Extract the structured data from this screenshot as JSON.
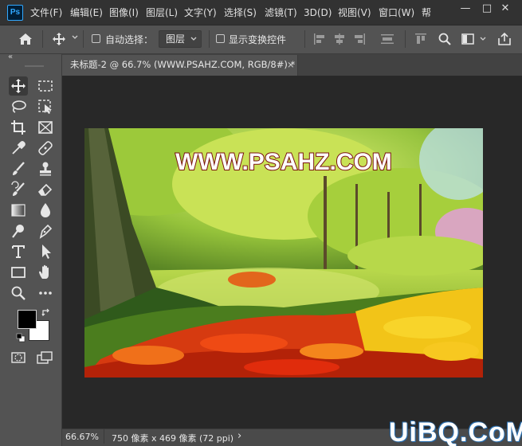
{
  "app": {
    "logo_text": "Ps"
  },
  "menubar": {
    "items": [
      {
        "label": "文件(F)"
      },
      {
        "label": "编辑(E)"
      },
      {
        "label": "图像(I)"
      },
      {
        "label": "图层(L)"
      },
      {
        "label": "文字(Y)"
      },
      {
        "label": "选择(S)"
      },
      {
        "label": "滤镜(T)"
      },
      {
        "label": "3D(D)"
      },
      {
        "label": "视图(V)"
      },
      {
        "label": "窗口(W)"
      },
      {
        "label": "帮"
      }
    ]
  },
  "window_controls": {
    "minimize": "—",
    "maximize": "□",
    "close": "✕"
  },
  "options_bar": {
    "auto_select_label": "自动选择：",
    "layer_select_value": "图层",
    "show_transform_label": "显示变换控件"
  },
  "toolbar": {
    "collapse_glyph": "«"
  },
  "document": {
    "tab_title": "未标题-2 @ 66.7% (WWW.PSAHZ.COM, RGB/8#) *",
    "tab_close": "×",
    "canvas_text": "WWW.PSAHZ.COM"
  },
  "statusbar": {
    "zoom": "66.67%",
    "doc_info": "750 像素 x 469 像素 (72 ppi)",
    "arrow": "›"
  },
  "watermark": {
    "text": "UiBQ.CoM"
  },
  "colors": {
    "accent": "#31a8ff",
    "chrome_dark": "#323232",
    "panel": "#535353",
    "workspace": "#282828",
    "foreground_swatch": "#000000",
    "background_swatch": "#ffffff"
  }
}
